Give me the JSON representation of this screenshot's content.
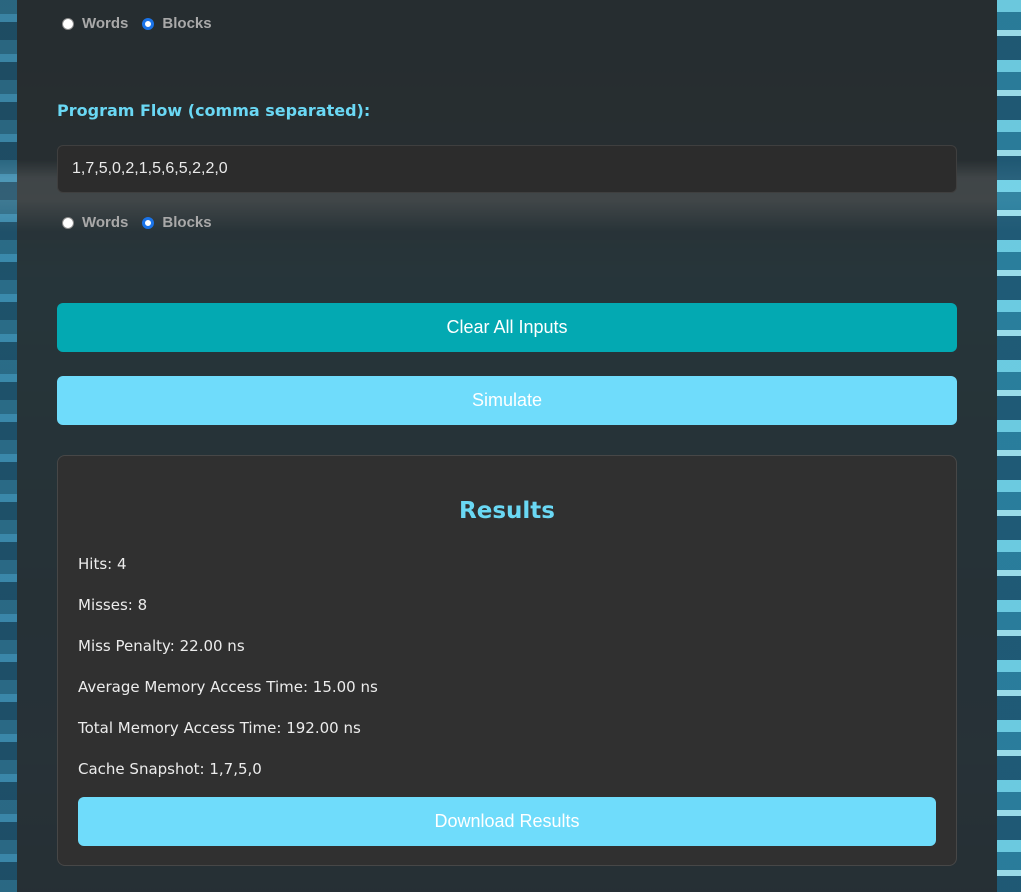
{
  "block_size_unit": {
    "options": [
      "Words",
      "Blocks"
    ],
    "selected": "Blocks"
  },
  "program_flow": {
    "label": "Program Flow (comma separated):",
    "value": "1,7,5,0,2,1,5,6,5,2,2,0",
    "unit_options": [
      "Words",
      "Blocks"
    ],
    "unit_selected": "Blocks"
  },
  "buttons": {
    "clear": "Clear All Inputs",
    "simulate": "Simulate",
    "download": "Download Results"
  },
  "results": {
    "title": "Results",
    "hits": "Hits: 4",
    "misses": "Misses: 8",
    "miss_penalty": "Miss Penalty: 22.00 ns",
    "amat": "Average Memory Access Time: 15.00 ns",
    "total_time": "Total Memory Access Time: 192.00 ns",
    "snapshot": "Cache Snapshot: 1,7,5,0"
  },
  "colors": {
    "accent": "#6ad8f4",
    "clear_button": "#03a9b2",
    "primary_button": "#6fdcfb",
    "radio_checked": "#1a73e8"
  }
}
